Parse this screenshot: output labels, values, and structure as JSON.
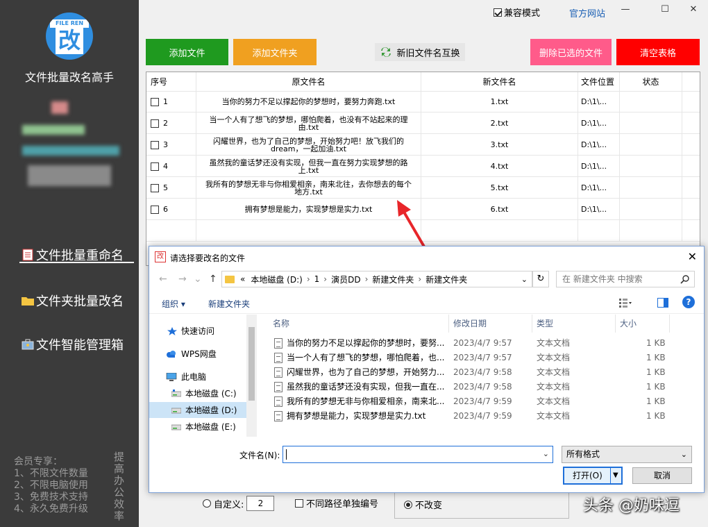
{
  "sidebar": {
    "logo_tag": "FILE REN",
    "logo_char": "改",
    "app_title": "文件批量改名高手",
    "nav": [
      {
        "label": "文件批量重命名"
      },
      {
        "label": "文件夹批量改名"
      },
      {
        "label": "文件智能管理箱"
      }
    ],
    "member_lines": [
      "会员专享：",
      "1、不限文件数量",
      "2、不限电脑使用",
      "3、免费技术支持",
      "4、永久免费升级"
    ],
    "slogan": "提高办公效率"
  },
  "topbar": {
    "compat_label": "兼容模式",
    "compat_checked": true,
    "official_link": "官方网站",
    "minimize": "—",
    "maximize": "☐",
    "close": "✕"
  },
  "toolbar": {
    "add_file": "添加文件",
    "add_folder": "添加文件夹",
    "swap": "新旧文件名互换",
    "delete_selected": "删除已选的文件",
    "clear_table": "清空表格",
    "colors": {
      "add_file": "#1f9a1f",
      "add_folder": "#f0a020",
      "delete": "#ff5b8a",
      "clear": "#ff0000"
    }
  },
  "table": {
    "headers": [
      "序号",
      "原文件名",
      "新文件名",
      "文件位置",
      "状态"
    ],
    "rows": [
      {
        "no": "1",
        "original": "当你的努力不足以撑起你的梦想时，要努力奔跑.txt",
        "new": "1.txt",
        "location": "D:\\1\\..."
      },
      {
        "no": "2",
        "original": "当一个人有了想飞的梦想，哪怕爬着，也没有不站起来的理由.txt",
        "new": "2.txt",
        "location": "D:\\1\\..."
      },
      {
        "no": "3",
        "original": "闪耀世界，也为了自己的梦想，开始努力吧！放飞我们的dream，一起加油.txt",
        "new": "3.txt",
        "location": "D:\\1\\..."
      },
      {
        "no": "4",
        "original": "虽然我的童话梦还没有实现，但我一直在努力实现梦想的路上.txt",
        "new": "4.txt",
        "location": "D:\\1\\..."
      },
      {
        "no": "5",
        "original": "我所有的梦想无非与你相爱相亲，南来北往，去你想去的每个地方.txt",
        "new": "5.txt",
        "location": "D:\\1\\..."
      },
      {
        "no": "6",
        "original": "拥有梦想是能力，实现梦想是实力.txt",
        "new": "6.txt",
        "location": "D:\\1\\..."
      }
    ]
  },
  "options": {
    "custom_label": "自定义:",
    "custom_value": "2",
    "per_path_label": "不同路径单独编号",
    "unchanged_label": "不改变"
  },
  "watermark": "头条 @奶味逗",
  "dialog": {
    "icon_char": "改",
    "title": "请选择要改名的文件",
    "close": "✕",
    "breadcrumb": [
      "本地磁盘 (D:)",
      "1",
      "演员DD",
      "新建文件夹",
      "新建文件夹"
    ],
    "breadcrumb_prefix": "«",
    "search_placeholder": "在 新建文件夹 中搜索",
    "organize": "组织 ▾",
    "new_folder": "新建文件夹",
    "help": "?",
    "nav_items": [
      {
        "label": "快速访问",
        "icon": "star-icon"
      },
      {
        "label": "WPS网盘",
        "icon": "cloud-icon"
      },
      {
        "label": "此电脑",
        "icon": "computer-icon"
      },
      {
        "label": "本地磁盘 (C:)",
        "icon": "drive-icon"
      },
      {
        "label": "本地磁盘 (D:)",
        "icon": "drive-icon"
      },
      {
        "label": "本地磁盘 (E:)",
        "icon": "drive-icon"
      }
    ],
    "list_headers": [
      "名称",
      "修改日期",
      "类型",
      "大小"
    ],
    "files": [
      {
        "name": "当你的努力不足以撑起你的梦想时，要努...",
        "date": "2023/4/7 9:57",
        "type": "文本文档",
        "size": "1 KB"
      },
      {
        "name": "当一个人有了想飞的梦想，哪怕爬着，也...",
        "date": "2023/4/7 9:57",
        "type": "文本文档",
        "size": "1 KB"
      },
      {
        "name": "闪耀世界，也为了自己的梦想，开始努力...",
        "date": "2023/4/7 9:58",
        "type": "文本文档",
        "size": "1 KB"
      },
      {
        "name": "虽然我的童话梦还没有实现，但我一直在...",
        "date": "2023/4/7 9:58",
        "type": "文本文档",
        "size": "1 KB"
      },
      {
        "name": "我所有的梦想无非与你相爱相亲，南来北...",
        "date": "2023/4/7 9:59",
        "type": "文本文档",
        "size": "1 KB"
      },
      {
        "name": "拥有梦想是能力，实现梦想是实力.txt",
        "date": "2023/4/7 9:59",
        "type": "文本文档",
        "size": "1 KB"
      }
    ],
    "filename_label": "文件名(N):",
    "filename_value": "",
    "filter": "所有格式",
    "open": "打开(O)",
    "cancel": "取消"
  }
}
